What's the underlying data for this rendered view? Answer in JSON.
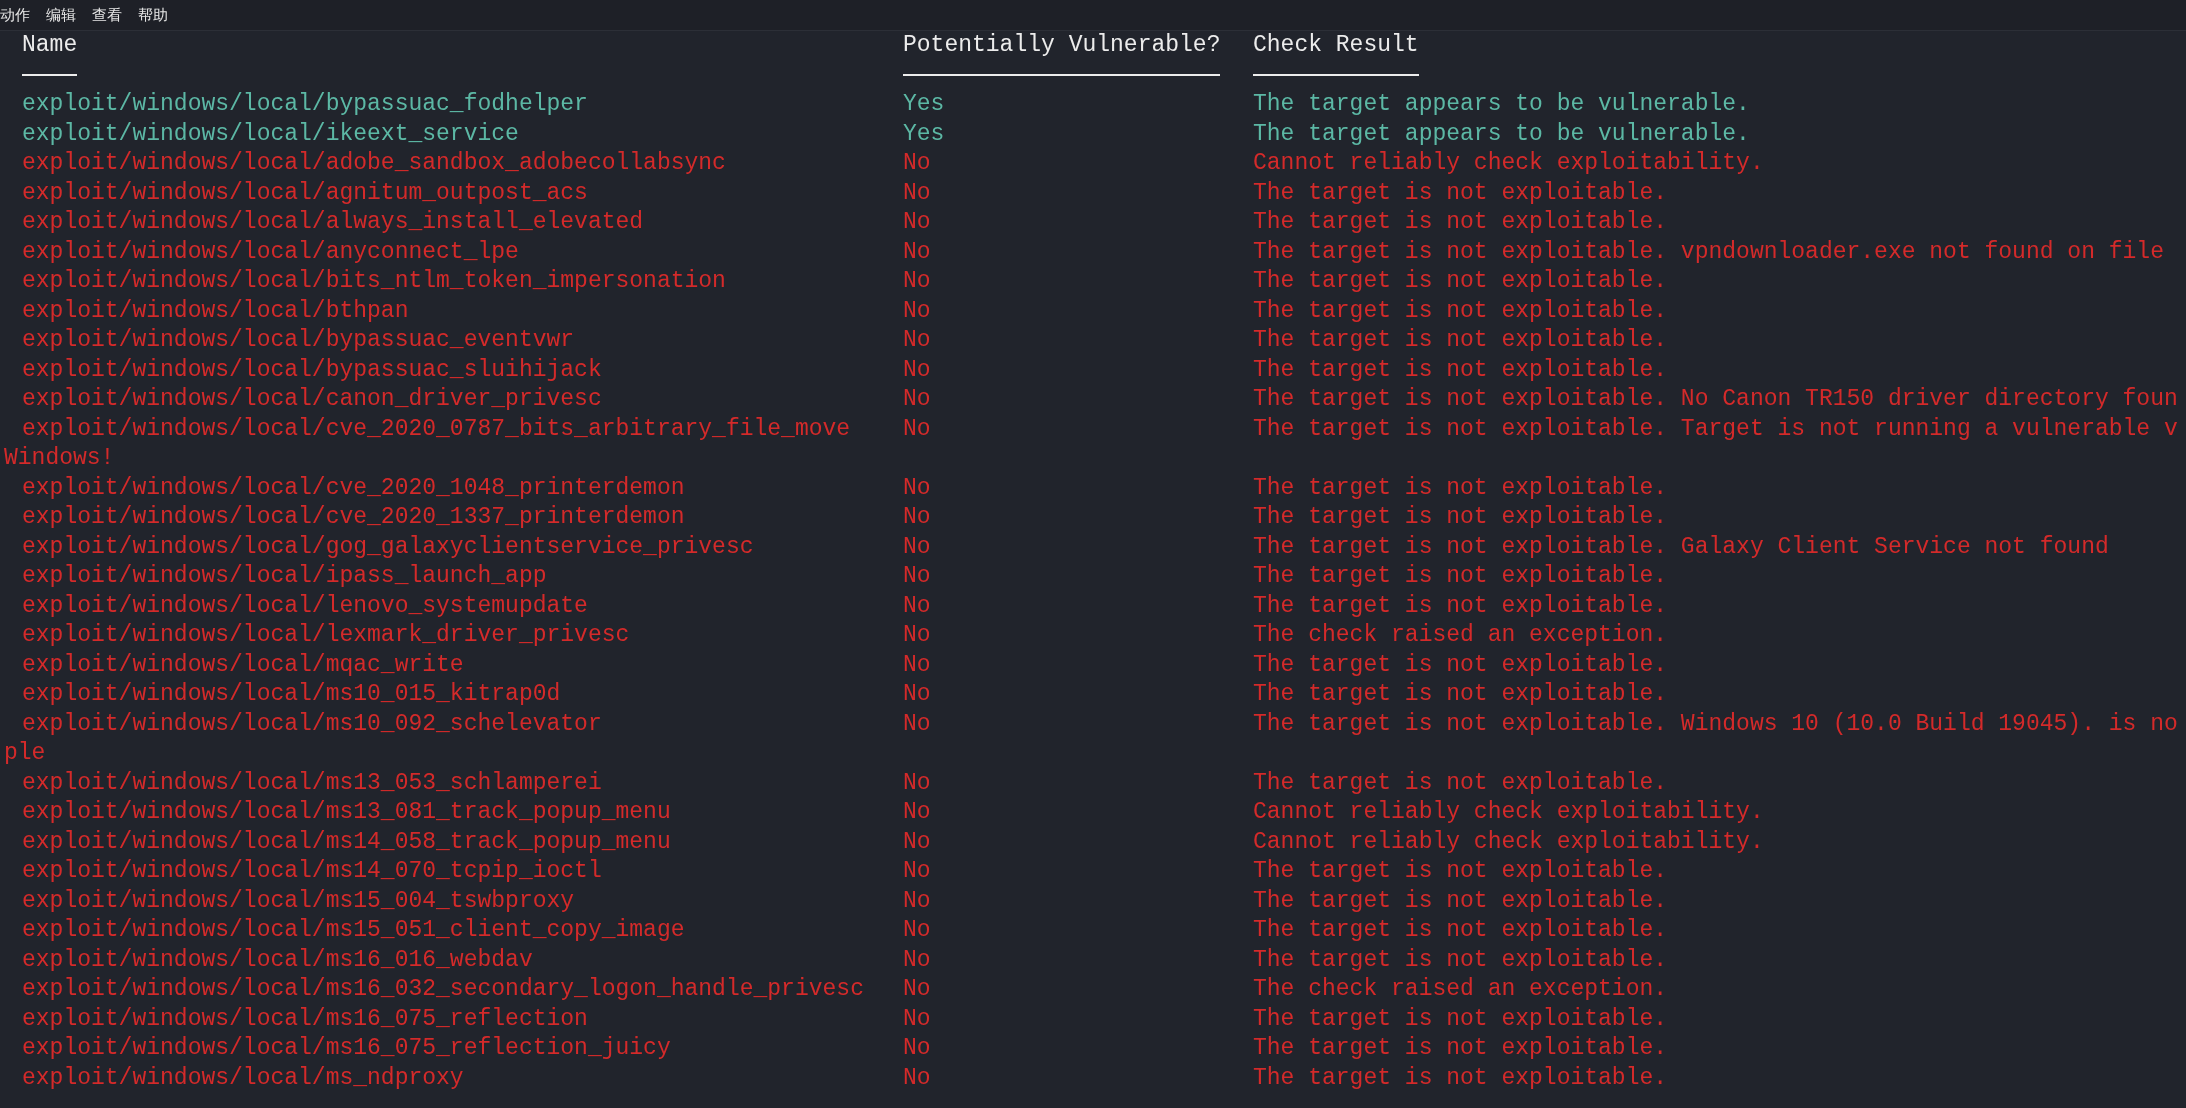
{
  "menu": [
    {
      "label": "动作"
    },
    {
      "label": "编辑"
    },
    {
      "label": "查看"
    },
    {
      "label": "帮助"
    }
  ],
  "table": {
    "columns": [
      "Name",
      "Potentially Vulnerable?",
      "Check Result"
    ],
    "rows": [
      {
        "name": "exploit/windows/local/bypassuac_fodhelper",
        "vulnerable": true,
        "answer": "Yes",
        "result": "The target appears to be vulnerable."
      },
      {
        "name": "exploit/windows/local/ikeext_service",
        "vulnerable": true,
        "answer": "Yes",
        "result": "The target appears to be vulnerable."
      },
      {
        "name": "exploit/windows/local/adobe_sandbox_adobecollabsync",
        "vulnerable": false,
        "answer": "No",
        "result": "Cannot reliably check exploitability."
      },
      {
        "name": "exploit/windows/local/agnitum_outpost_acs",
        "vulnerable": false,
        "answer": "No",
        "result": "The target is not exploitable."
      },
      {
        "name": "exploit/windows/local/always_install_elevated",
        "vulnerable": false,
        "answer": "No",
        "result": "The target is not exploitable."
      },
      {
        "name": "exploit/windows/local/anyconnect_lpe",
        "vulnerable": false,
        "answer": "No",
        "result": "The target is not exploitable. vpndownloader.exe not found on file"
      },
      {
        "name": "exploit/windows/local/bits_ntlm_token_impersonation",
        "vulnerable": false,
        "answer": "No",
        "result": "The target is not exploitable."
      },
      {
        "name": "exploit/windows/local/bthpan",
        "vulnerable": false,
        "answer": "No",
        "result": "The target is not exploitable."
      },
      {
        "name": "exploit/windows/local/bypassuac_eventvwr",
        "vulnerable": false,
        "answer": "No",
        "result": "The target is not exploitable."
      },
      {
        "name": "exploit/windows/local/bypassuac_sluihijack",
        "vulnerable": false,
        "answer": "No",
        "result": "The target is not exploitable."
      },
      {
        "name": "exploit/windows/local/canon_driver_privesc",
        "vulnerable": false,
        "answer": "No",
        "result": "The target is not exploitable. No Canon TR150 driver directory foun"
      },
      {
        "name": "exploit/windows/local/cve_2020_0787_bits_arbitrary_file_move",
        "vulnerable": false,
        "answer": "No",
        "result": "The target is not exploitable. Target is not running a vulnerable v",
        "overflow": "Windows!"
      },
      {
        "name": "exploit/windows/local/cve_2020_1048_printerdemon",
        "vulnerable": false,
        "answer": "No",
        "result": "The target is not exploitable."
      },
      {
        "name": "exploit/windows/local/cve_2020_1337_printerdemon",
        "vulnerable": false,
        "answer": "No",
        "result": "The target is not exploitable."
      },
      {
        "name": "exploit/windows/local/gog_galaxyclientservice_privesc",
        "vulnerable": false,
        "answer": "No",
        "result": "The target is not exploitable. Galaxy Client Service not found"
      },
      {
        "name": "exploit/windows/local/ipass_launch_app",
        "vulnerable": false,
        "answer": "No",
        "result": "The target is not exploitable."
      },
      {
        "name": "exploit/windows/local/lenovo_systemupdate",
        "vulnerable": false,
        "answer": "No",
        "result": "The target is not exploitable."
      },
      {
        "name": "exploit/windows/local/lexmark_driver_privesc",
        "vulnerable": false,
        "answer": "No",
        "result": "The check raised an exception."
      },
      {
        "name": "exploit/windows/local/mqac_write",
        "vulnerable": false,
        "answer": "No",
        "result": "The target is not exploitable."
      },
      {
        "name": "exploit/windows/local/ms10_015_kitrap0d",
        "vulnerable": false,
        "answer": "No",
        "result": "The target is not exploitable."
      },
      {
        "name": "exploit/windows/local/ms10_092_schelevator",
        "vulnerable": false,
        "answer": "No",
        "result": "The target is not exploitable. Windows 10 (10.0 Build 19045). is no",
        "overflow": "ple"
      },
      {
        "name": "exploit/windows/local/ms13_053_schlamperei",
        "vulnerable": false,
        "answer": "No",
        "result": "The target is not exploitable."
      },
      {
        "name": "exploit/windows/local/ms13_081_track_popup_menu",
        "vulnerable": false,
        "answer": "No",
        "result": "Cannot reliably check exploitability."
      },
      {
        "name": "exploit/windows/local/ms14_058_track_popup_menu",
        "vulnerable": false,
        "answer": "No",
        "result": "Cannot reliably check exploitability."
      },
      {
        "name": "exploit/windows/local/ms14_070_tcpip_ioctl",
        "vulnerable": false,
        "answer": "No",
        "result": "The target is not exploitable."
      },
      {
        "name": "exploit/windows/local/ms15_004_tswbproxy",
        "vulnerable": false,
        "answer": "No",
        "result": "The target is not exploitable."
      },
      {
        "name": "exploit/windows/local/ms15_051_client_copy_image",
        "vulnerable": false,
        "answer": "No",
        "result": "The target is not exploitable."
      },
      {
        "name": "exploit/windows/local/ms16_016_webdav",
        "vulnerable": false,
        "answer": "No",
        "result": "The target is not exploitable."
      },
      {
        "name": "exploit/windows/local/ms16_032_secondary_logon_handle_privesc",
        "vulnerable": false,
        "answer": "No",
        "result": "The check raised an exception."
      },
      {
        "name": "exploit/windows/local/ms16_075_reflection",
        "vulnerable": false,
        "answer": "No",
        "result": "The target is not exploitable."
      },
      {
        "name": "exploit/windows/local/ms16_075_reflection_juicy",
        "vulnerable": false,
        "answer": "No",
        "result": "The target is not exploitable."
      },
      {
        "name": "exploit/windows/local/ms_ndproxy",
        "vulnerable": false,
        "answer": "No",
        "result": "The target is not exploitable."
      }
    ]
  }
}
